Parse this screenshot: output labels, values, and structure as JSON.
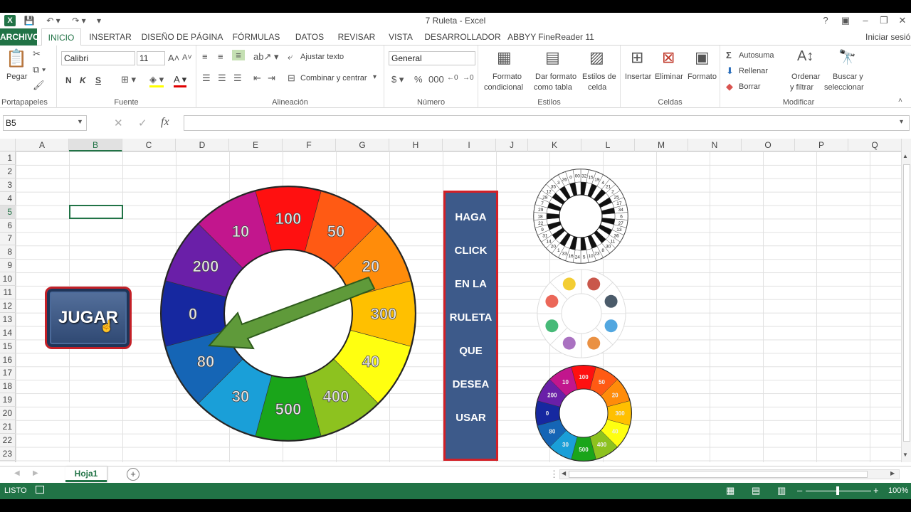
{
  "titlebar": {
    "title": "7 Ruleta - Excel",
    "help": "?",
    "minimize": "–",
    "restore": "❐",
    "close": "✕"
  },
  "tabs": [
    "ARCHIVO",
    "INICIO",
    "INSERTAR",
    "DISEÑO DE PÁGINA",
    "FÓRMULAS",
    "DATOS",
    "REVISAR",
    "VISTA",
    "DESARROLLADOR",
    "ABBYY FineReader 11"
  ],
  "signin": "Iniciar sesión",
  "ribbon": {
    "clipboard": {
      "paste": "Pegar",
      "label": "Portapapeles"
    },
    "font": {
      "name": "Calibri",
      "size": "11",
      "bold": "N",
      "italic": "K",
      "underline": "S",
      "label": "Fuente"
    },
    "alignment": {
      "wrap": "Ajustar texto",
      "merge": "Combinar y centrar",
      "label": "Alineación"
    },
    "number": {
      "format": "General",
      "label": "Número"
    },
    "styles": {
      "cond1": "Formato",
      "cond2": "condicional",
      "table1": "Dar formato",
      "table2": "como tabla",
      "cell1": "Estilos de",
      "cell2": "celda",
      "label": "Estilos"
    },
    "cells": {
      "insert": "Insertar",
      "delete": "Eliminar",
      "format": "Formato",
      "label": "Celdas"
    },
    "modify": {
      "autosum": "Autosuma",
      "fill": "Rellenar",
      "clear": "Borrar",
      "sort1": "Ordenar",
      "sort2": "y filtrar",
      "find1": "Buscar y",
      "find2": "seleccionar",
      "label": "Modificar"
    }
  },
  "formula_bar": {
    "name_box": "B5",
    "fx": "fx",
    "value": ""
  },
  "columns": [
    "A",
    "B",
    "C",
    "D",
    "E",
    "F",
    "G",
    "H",
    "I",
    "J",
    "K",
    "L",
    "M",
    "N",
    "O",
    "P",
    "Q"
  ],
  "rows": [
    "1",
    "2",
    "3",
    "4",
    "5",
    "6",
    "7",
    "8",
    "9",
    "10",
    "11",
    "12",
    "13",
    "14",
    "15",
    "16",
    "17",
    "18",
    "19",
    "20",
    "21",
    "22",
    "23"
  ],
  "selected_cell": "B5",
  "jugar_button": "JUGAR",
  "roulette": {
    "segments": [
      {
        "label": "100",
        "color": "#ff1010"
      },
      {
        "label": "50",
        "color": "#ff5a14"
      },
      {
        "label": "20",
        "color": "#ff8c0a"
      },
      {
        "label": "300",
        "color": "#ffc000"
      },
      {
        "label": "40",
        "color": "#ffff10"
      },
      {
        "label": "400",
        "color": "#8dc21f"
      },
      {
        "label": "500",
        "color": "#1aa51a"
      },
      {
        "label": "30",
        "color": "#1a9fd8"
      },
      {
        "label": "80",
        "color": "#1565b5"
      },
      {
        "label": "0",
        "color": "#1628a0"
      },
      {
        "label": "200",
        "color": "#6a1fa8"
      },
      {
        "label": "10",
        "color": "#c2168d"
      }
    ]
  },
  "instructions": [
    "HAGA",
    "CLICK",
    "EN LA",
    "RULETA",
    "QUE",
    "DESEA",
    "USAR"
  ],
  "thumb_numbers": [
    "32",
    "15",
    "19",
    "4",
    "21",
    "2",
    "25",
    "17",
    "34",
    "6",
    "27",
    "13",
    "36",
    "11",
    "30",
    "8",
    "23",
    "10",
    "5",
    "24",
    "16",
    "33",
    "1",
    "20",
    "14",
    "31",
    "9",
    "22",
    "18",
    "29",
    "7",
    "28",
    "12",
    "35",
    "3",
    "26",
    "0",
    "00"
  ],
  "sheet_tab": "Hoja1",
  "status": {
    "mode": "LISTO",
    "zoom": "100%"
  },
  "colors": {
    "excel_green": "#217346",
    "panel_blue": "#3d5a8a",
    "panel_border": "#d32027"
  }
}
